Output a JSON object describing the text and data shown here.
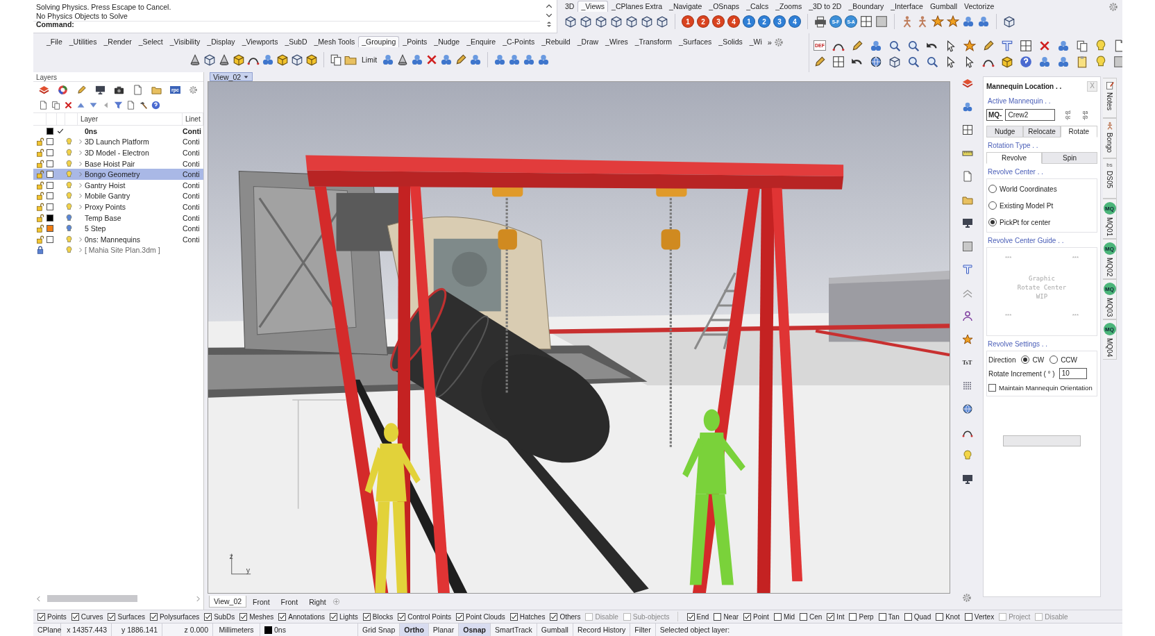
{
  "command": {
    "lines": [
      "Solving Physics. Press Escape to Cancel.",
      "No Physics Objects to Solve"
    ],
    "prompt": "Command:"
  },
  "top_tabs": [
    {
      "label": "3D",
      "selected": false
    },
    {
      "label": "_Views",
      "selected": true
    },
    {
      "label": "_CPlanes Extra",
      "selected": false
    },
    {
      "label": "_Navigate",
      "selected": false
    },
    {
      "label": "_OSnaps",
      "selected": false
    },
    {
      "label": "_Calcs",
      "selected": false
    },
    {
      "label": "_Zooms",
      "selected": false
    },
    {
      "label": "_3D to 2D",
      "selected": false
    },
    {
      "label": "_Boundary",
      "selected": false
    },
    {
      "label": "_Interface",
      "selected": false
    },
    {
      "label": "Gumball",
      "selected": false
    },
    {
      "label": "Vectorize",
      "selected": false
    }
  ],
  "view_buttons": [
    {
      "label": "1",
      "color": "#d9431f"
    },
    {
      "label": "2",
      "color": "#d9431f"
    },
    {
      "label": "3",
      "color": "#d9431f"
    },
    {
      "label": "4",
      "color": "#d9431f"
    },
    {
      "label": "1",
      "color": "#2f7fd6"
    },
    {
      "label": "2",
      "color": "#2f7fd6"
    },
    {
      "label": "3",
      "color": "#2f7fd6"
    },
    {
      "label": "4",
      "color": "#2f7fd6"
    }
  ],
  "saved_view_buttons": [
    {
      "label": "S-F",
      "color": "#3d8fd8"
    },
    {
      "label": "S-A",
      "color": "#3d8fd8"
    }
  ],
  "main_tabs": [
    {
      "label": "_File",
      "selected": false
    },
    {
      "label": "_Utilities",
      "selected": false
    },
    {
      "label": "_Render",
      "selected": false
    },
    {
      "label": "_Select",
      "selected": false
    },
    {
      "label": "_Visibility",
      "selected": false
    },
    {
      "label": "_Display",
      "selected": false
    },
    {
      "label": "_Viewports",
      "selected": false
    },
    {
      "label": "_SubD",
      "selected": false
    },
    {
      "label": "_Mesh Tools",
      "selected": false
    },
    {
      "label": "_Grouping",
      "selected": true
    },
    {
      "label": "_Points",
      "selected": false
    },
    {
      "label": "_Nudge",
      "selected": false
    },
    {
      "label": "_Enquire",
      "selected": false
    },
    {
      "label": "_C-Points",
      "selected": false
    },
    {
      "label": "_Rebuild",
      "selected": false
    },
    {
      "label": "_Draw",
      "selected": false
    },
    {
      "label": "_Wires",
      "selected": false
    },
    {
      "label": "_Transform",
      "selected": false
    },
    {
      "label": "_Surfaces",
      "selected": false
    },
    {
      "label": "_Solids",
      "selected": false
    },
    {
      "label": "_Wi",
      "selected": false
    }
  ],
  "main_tabs_overflow": "»",
  "toolbar": {
    "text_button": "Limit",
    "icon_text": "DEF"
  },
  "layers": {
    "title": "Layers",
    "tab_icon_text": "rpc",
    "columns": [
      "Layer",
      "Linet"
    ],
    "rows": [
      {
        "name": "0ns",
        "linetype": "Conti",
        "kind": "current",
        "color": "#000000",
        "expandable": false,
        "selected": false
      },
      {
        "name": "3D Launch Platform",
        "linetype": "Conti",
        "kind": "layer",
        "color": "#ffffff",
        "expandable": true,
        "bulb_on": true,
        "selected": false
      },
      {
        "name": "3D Model - Electron",
        "linetype": "Conti",
        "kind": "layer",
        "color": "#ffffff",
        "expandable": true,
        "bulb_on": true,
        "selected": false
      },
      {
        "name": "Base Hoist Pair",
        "linetype": "Conti",
        "kind": "layer",
        "color": "#ffffff",
        "expandable": true,
        "bulb_on": true,
        "selected": false
      },
      {
        "name": "Bongo Geometry",
        "linetype": "Conti",
        "kind": "layer",
        "color": "#ffffff",
        "expandable": true,
        "bulb_on": true,
        "selected": true
      },
      {
        "name": "Gantry Hoist",
        "linetype": "Conti",
        "kind": "layer",
        "color": "#ffffff",
        "expandable": true,
        "bulb_on": true,
        "selected": false
      },
      {
        "name": "Mobile Gantry",
        "linetype": "Conti",
        "kind": "layer",
        "color": "#ffffff",
        "expandable": true,
        "bulb_on": true,
        "selected": false
      },
      {
        "name": "Proxy Points",
        "linetype": "Conti",
        "kind": "layer",
        "color": "#ffffff",
        "expandable": true,
        "bulb_on": true,
        "selected": false
      },
      {
        "name": "Temp Base",
        "linetype": "Conti",
        "kind": "layer",
        "color": "#000000",
        "expandable": false,
        "bulb_on": false,
        "selected": false
      },
      {
        "name": "5 Step",
        "linetype": "Conti",
        "kind": "layer",
        "color": "#f07d12",
        "expandable": false,
        "bulb_on": false,
        "selected": false
      },
      {
        "name": "0ns: Mannequins",
        "linetype": "Conti",
        "kind": "layer",
        "color": "#ffffff",
        "expandable": true,
        "bulb_on": true,
        "selected": false
      },
      {
        "name": "[ Mahia Site Plan.3dm ]",
        "kind": "reference",
        "expandable": true,
        "bulb_on": true,
        "selected": false
      }
    ]
  },
  "viewport": {
    "title": "View_02",
    "axis_labels": [
      "z",
      "y"
    ],
    "tabs": [
      {
        "label": "View_02",
        "selected": true
      },
      {
        "label": "Front",
        "selected": false
      },
      {
        "label": "Front",
        "selected": false
      },
      {
        "label": "Right",
        "selected": false
      }
    ]
  },
  "side_icon_text": "TsT",
  "panel": {
    "title": "Mannequin Location . .",
    "close": "X",
    "active_label": "Active Mannequin . .",
    "prefix": "MQ-",
    "mannequin": "Crew2",
    "swap_buttons": [
      [
        "qd",
        "qc"
      ],
      [
        "qa",
        "qb"
      ]
    ],
    "tabs": [
      {
        "label": "Nudge",
        "selected": false
      },
      {
        "label": "Relocate",
        "selected": false
      },
      {
        "label": "Rotate",
        "selected": true
      }
    ],
    "rotation_label": "Rotation Type . .",
    "rotation_tabs": [
      {
        "label": "Revolve",
        "selected": true
      },
      {
        "label": "Spin",
        "selected": false
      }
    ],
    "center_label": "Revolve Center . .",
    "center_options": [
      {
        "label": "World Coordinates",
        "selected": false
      },
      {
        "label": "Existing Model Pt",
        "selected": false
      },
      {
        "label": "PickPt for center",
        "selected": true
      }
    ],
    "guide_label": "Revolve Center Guide . .",
    "guide_marks": [
      "***",
      "***",
      "***",
      "***"
    ],
    "guide_text": [
      "Graphic",
      "Rotate Center",
      "WIP"
    ],
    "settings_label": "Revolve Settings . .",
    "direction_label": "Direction",
    "directions": [
      {
        "label": "CW",
        "selected": true
      },
      {
        "label": "CCW",
        "selected": false
      }
    ],
    "increment_label": "Rotate Increment ( ° )",
    "increment": "10",
    "maintain": {
      "label": "Maintain Mannequin Orientation",
      "checked": false
    }
  },
  "side_tabs": [
    {
      "label": "Notes"
    },
    {
      "label": "Bongo"
    },
    {
      "label": "DS05",
      "badge": "bs"
    },
    {
      "label": "MQ01",
      "badge": "MQ"
    },
    {
      "label": "MQ02",
      "badge": "MQ"
    },
    {
      "label": "MQ03",
      "badge": "MQ"
    },
    {
      "label": "MQ04",
      "badge": "MQ"
    }
  ],
  "object_filters": [
    {
      "label": "Points",
      "checked": true,
      "disabled": false
    },
    {
      "label": "Curves",
      "checked": true,
      "disabled": false
    },
    {
      "label": "Surfaces",
      "checked": true,
      "disabled": false
    },
    {
      "label": "Polysurfaces",
      "checked": true,
      "disabled": false
    },
    {
      "label": "SubDs",
      "checked": true,
      "disabled": false
    },
    {
      "label": "Meshes",
      "checked": true,
      "disabled": false
    },
    {
      "label": "Annotations",
      "checked": true,
      "disabled": false
    },
    {
      "label": "Lights",
      "checked": true,
      "disabled": false
    },
    {
      "label": "Blocks",
      "checked": true,
      "disabled": false
    },
    {
      "label": "Control Points",
      "checked": true,
      "disabled": false
    },
    {
      "label": "Point Clouds",
      "checked": true,
      "disabled": false
    },
    {
      "label": "Hatches",
      "checked": true,
      "disabled": false
    },
    {
      "label": "Others",
      "checked": true,
      "disabled": false
    },
    {
      "label": "Disable",
      "checked": false,
      "disabled": true
    },
    {
      "label": "Sub-objects",
      "checked": false,
      "disabled": true
    }
  ],
  "osnaps": [
    {
      "label": "End",
      "checked": true,
      "disabled": false
    },
    {
      "label": "Near",
      "checked": false,
      "disabled": false
    },
    {
      "label": "Point",
      "checked": true,
      "disabled": false
    },
    {
      "label": "Mid",
      "checked": false,
      "disabled": false
    },
    {
      "label": "Cen",
      "checked": false,
      "disabled": false
    },
    {
      "label": "Int",
      "checked": true,
      "disabled": false
    },
    {
      "label": "Perp",
      "checked": false,
      "disabled": false
    },
    {
      "label": "Tan",
      "checked": false,
      "disabled": false
    },
    {
      "label": "Quad",
      "checked": false,
      "disabled": false
    },
    {
      "label": "Knot",
      "checked": false,
      "disabled": false
    },
    {
      "label": "Vertex",
      "checked": false,
      "disabled": false
    },
    {
      "label": "Project",
      "checked": false,
      "disabled": true
    },
    {
      "label": "Disable",
      "checked": false,
      "disabled": true
    }
  ],
  "status": {
    "cplane": "CPlane",
    "x": "x 14357.443",
    "y": "y 1886.141",
    "z": "z 0.000",
    "units": "Millimeters",
    "layer": {
      "name": "0ns",
      "color": "#000000"
    },
    "toggles": [
      {
        "label": "Grid Snap",
        "on": false
      },
      {
        "label": "Ortho",
        "on": true
      },
      {
        "label": "Planar",
        "on": false
      },
      {
        "label": "Osnap",
        "on": true
      },
      {
        "label": "SmartTrack",
        "on": false
      },
      {
        "label": "Gumball",
        "on": false
      },
      {
        "label": "Record History",
        "on": false
      },
      {
        "label": "Filter",
        "on": false
      }
    ],
    "message": "Selected object layer:"
  }
}
